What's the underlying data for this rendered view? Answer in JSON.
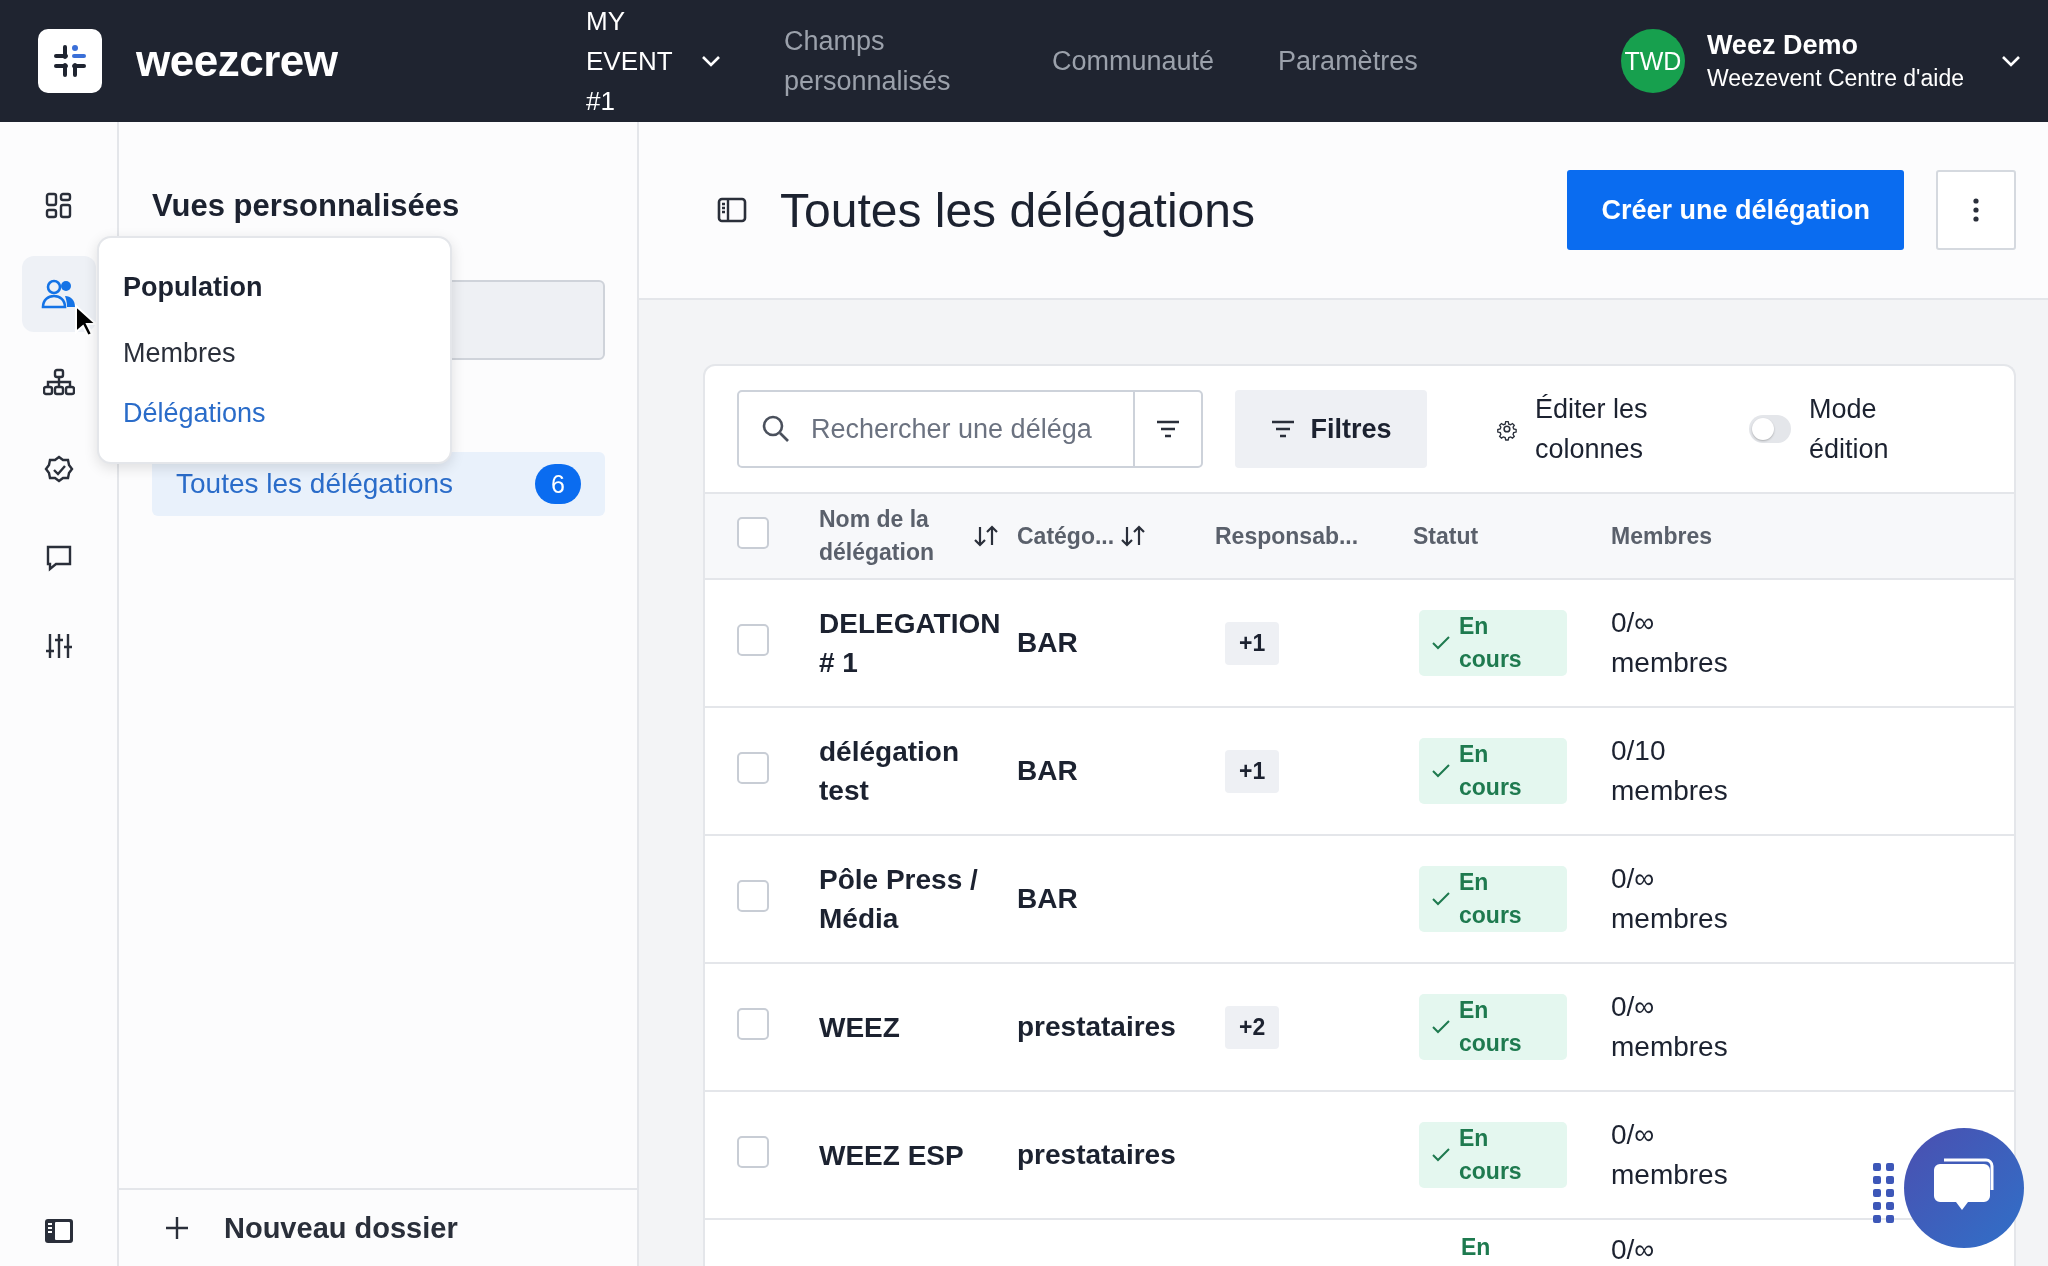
{
  "top_bar": {
    "brand": "weezcrew",
    "event": "MY EVENT #1",
    "nav": [
      {
        "label": "Champs personnalisés"
      },
      {
        "label": "Communauté"
      },
      {
        "label": "Paramètres"
      }
    ],
    "user": {
      "initials": "TWD",
      "name": "Weez Demo",
      "subtitle": "Weezevent Centre d'aide"
    }
  },
  "rail": {
    "items": [
      {
        "selected": false
      },
      {
        "selected": true
      },
      {
        "selected": false
      },
      {
        "selected": false
      },
      {
        "selected": false
      },
      {
        "selected": false
      }
    ]
  },
  "sidebar": {
    "title": "Vues personnalisées",
    "views": [
      {
        "label": "Toutes les délégations",
        "count": "6",
        "selected": true
      }
    ],
    "new_folder": "Nouveau dossier"
  },
  "popup_menu": {
    "title": "Population",
    "items": [
      {
        "label": "Membres",
        "selected": false
      },
      {
        "label": "Délégations",
        "selected": true
      }
    ]
  },
  "page": {
    "title": "Toutes les délégations",
    "create_button": "Créer une délégation"
  },
  "toolbar": {
    "search": {
      "placeholder": "Rechercher une déléga"
    },
    "filters": "Filtres",
    "edit_columns": "Éditer les colonnes",
    "edit_mode": {
      "label": "Mode édition",
      "on": false
    }
  },
  "table": {
    "select_all_checked": false,
    "columns": [
      {
        "label": "Nom de la délégation",
        "sortable": true
      },
      {
        "label": "Catégo...",
        "sortable": true
      },
      {
        "label": "Responsab...",
        "sortable": false
      },
      {
        "label": "Statut",
        "sortable": false
      },
      {
        "label": "Membres",
        "sortable": false
      }
    ],
    "rows": [
      {
        "checked": false,
        "name": "DELEGATION # 1",
        "category": "BAR",
        "responsables": "+1",
        "status": "En cours",
        "members": "0/∞ membres"
      },
      {
        "checked": false,
        "name": "délégation test",
        "category": "BAR",
        "responsables": "+1",
        "status": "En cours",
        "members": "0/10 membres"
      },
      {
        "checked": false,
        "name": "Pôle Press / Média",
        "category": "BAR",
        "status": "En cours",
        "members": "0/∞ membres"
      },
      {
        "checked": false,
        "name": "WEEZ",
        "category": "prestataires",
        "responsables": "+2",
        "status": "En cours",
        "members": "0/∞ membres"
      },
      {
        "checked": false,
        "name": "WEEZ ESP",
        "category": "prestataires",
        "status": "En cours",
        "members": "0/∞ membres"
      },
      {
        "kind": "partial",
        "status": "En",
        "members": "0/∞"
      }
    ]
  }
}
